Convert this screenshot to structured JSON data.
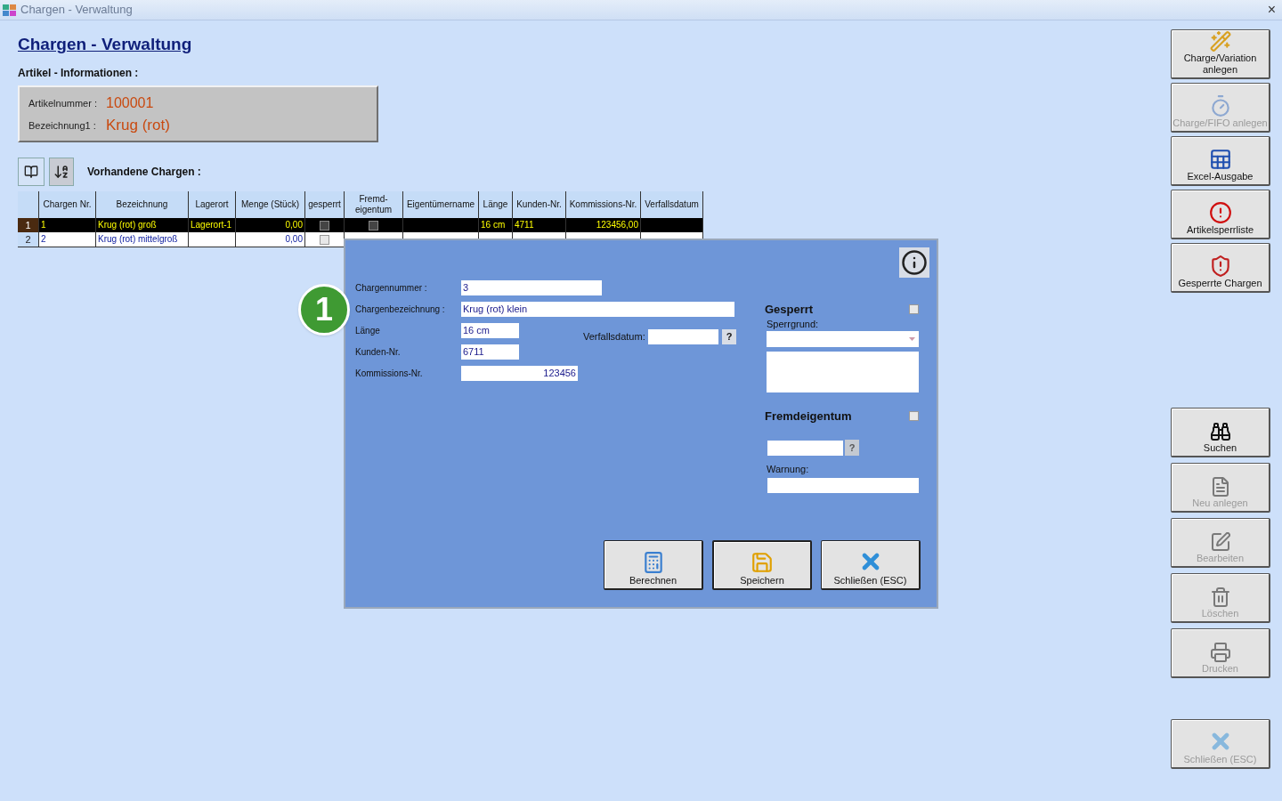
{
  "window": {
    "title": "Chargen - Verwaltung",
    "close": "×"
  },
  "page": {
    "title": "Chargen - Verwaltung"
  },
  "article_info": {
    "heading": "Artikel - Informationen :",
    "fields": [
      {
        "label": "Artikelnummer :",
        "value": "100001"
      },
      {
        "label": "Bezeichnung1 :",
        "value": "Krug (rot)"
      }
    ]
  },
  "table": {
    "heading": "Vorhandene Chargen :",
    "columns": [
      "Chargen Nr.",
      "Bezeichnung",
      "Lagerort",
      "Menge (Stück)",
      "gesperrt",
      "Fremd-\neigentum",
      "Eigentümername",
      "Länge",
      "Kunden-Nr.",
      "Kommissions-Nr.",
      "Verfallsdatum"
    ],
    "rows": [
      {
        "number": "1",
        "selected": true,
        "cells": [
          {
            "kind": "text",
            "text": "1"
          },
          {
            "kind": "text",
            "text": "Krug (rot) groß"
          },
          {
            "kind": "text",
            "text": "Lagerort-1"
          },
          {
            "kind": "number",
            "text": "0,00"
          },
          {
            "kind": "checkbox",
            "checked": false
          },
          {
            "kind": "checkbox",
            "checked": false
          },
          null,
          {
            "kind": "text",
            "text": "16 cm"
          },
          {
            "kind": "text",
            "text": "4711"
          },
          {
            "kind": "number",
            "text": "123456,00"
          },
          null
        ]
      },
      {
        "number": "2",
        "selected": false,
        "cells": [
          {
            "kind": "text",
            "text": "2"
          },
          {
            "kind": "text",
            "text": "Krug (rot) mittelgroß"
          },
          null,
          {
            "kind": "number",
            "text": "0,00"
          },
          {
            "kind": "checkbox",
            "checked": false
          }
        ]
      }
    ]
  },
  "dialog": {
    "fields": [
      {
        "label": "Chargennummer :",
        "value": "3",
        "kind": "text"
      },
      {
        "label": "Chargenbezeichnung :",
        "value": "Krug (rot) klein",
        "kind": "text"
      },
      {
        "label": "Länge",
        "value": "16 cm",
        "kind": "text"
      },
      {
        "label": "Kunden-Nr.",
        "value": "6711",
        "kind": "text"
      },
      {
        "label": "Kommissions-Nr.",
        "value": "123456",
        "kind": "number"
      }
    ],
    "expiry": {
      "label": "Verfallsdatum:",
      "help": "?"
    },
    "blocked": {
      "title": "Gesperrt",
      "checked": false,
      "reason_label": "Sperrgrund:"
    },
    "foreign": {
      "title": "Fremdeigentum",
      "checked": false,
      "help": "?",
      "warning_label": "Warnung:"
    },
    "buttons": [
      {
        "label": "Berechnen"
      },
      {
        "label": "Speichern",
        "selected": true
      },
      {
        "label": "Schließen (ESC)",
        "selected": false
      }
    ]
  },
  "callout": {
    "text": "1"
  },
  "sidebar": {
    "top_buttons": [
      {
        "label": "Charge/Variation anlegen",
        "disabled": false
      },
      {
        "label": "Charge/FIFO anlegen",
        "disabled": true
      },
      {
        "label": "Excel-Ausgabe",
        "disabled": false
      },
      {
        "label": "Artikelsperrliste",
        "disabled": false
      },
      {
        "label": "Gesperrte Chargen",
        "disabled": false
      }
    ],
    "bottom_buttons": [
      {
        "label": "Suchen",
        "disabled": false
      },
      {
        "label": "Neu anlegen",
        "disabled": true
      },
      {
        "label": "Bearbeiten",
        "disabled": true
      },
      {
        "label": "Löschen",
        "disabled": true
      },
      {
        "label": "Drucken",
        "disabled": true
      }
    ],
    "close_button": {
      "label": "Schließen (ESC)",
      "disabled": true
    }
  }
}
